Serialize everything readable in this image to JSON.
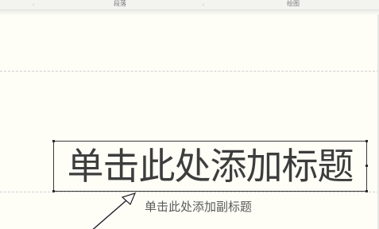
{
  "ribbon": {
    "groups": [
      {
        "label": "段落"
      },
      {
        "label": "绘图"
      }
    ]
  },
  "slide": {
    "title_placeholder": "单击此处添加标题",
    "subtitle_placeholder": "单击此处添加副标题"
  },
  "colors": {
    "background": "#fefef7",
    "ribbon": "#f3f3f0",
    "border": "#3a3a3a",
    "title_text": "#3d3d3d",
    "subtitle_text": "#5a5a5a"
  }
}
